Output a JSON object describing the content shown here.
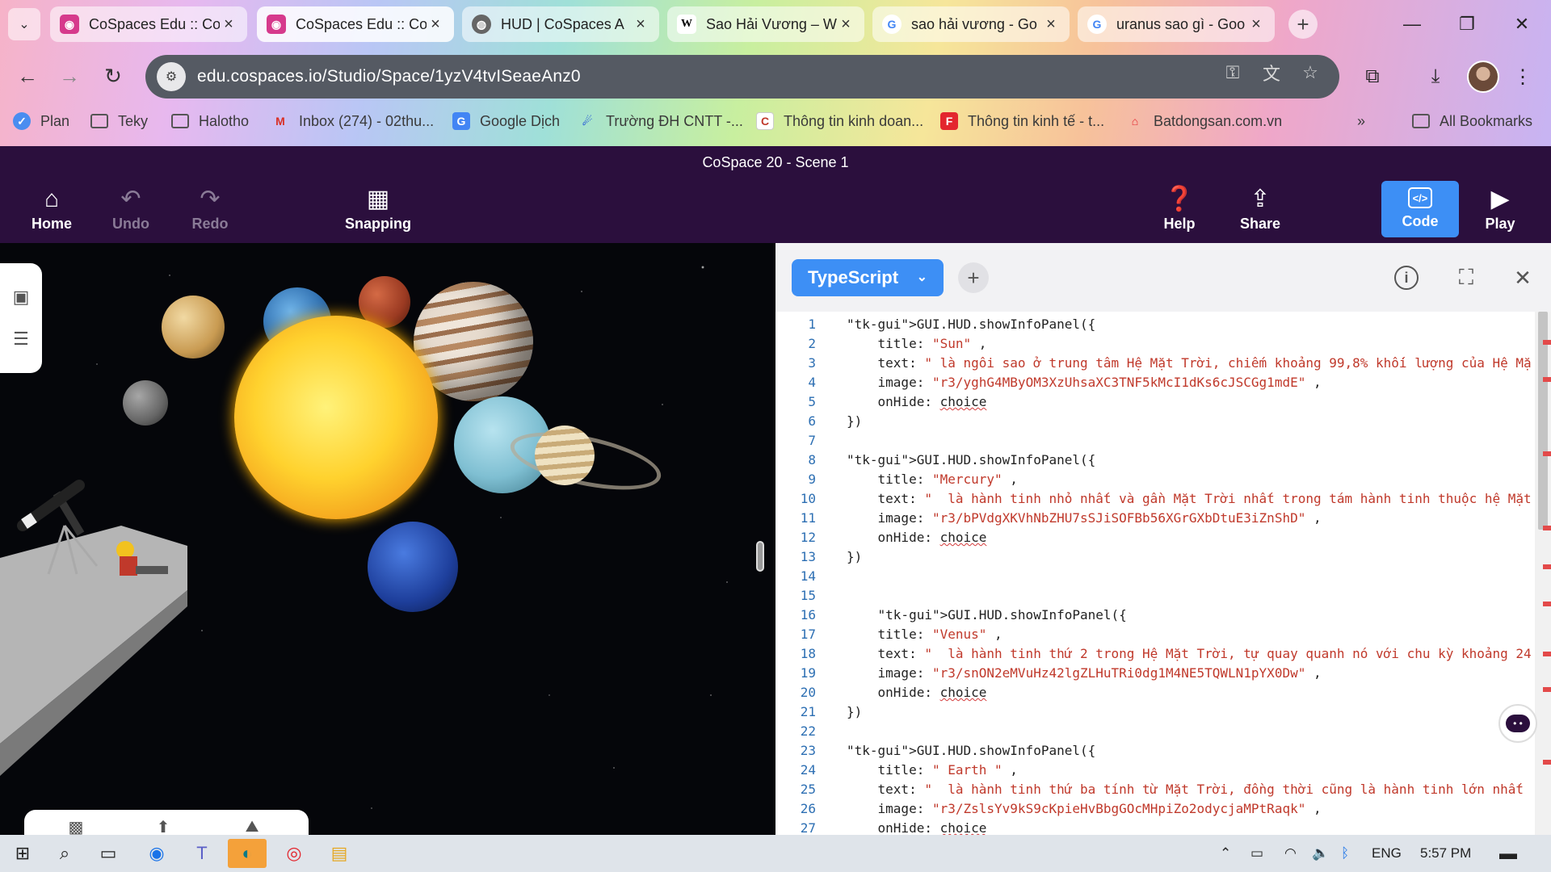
{
  "browser": {
    "tabs": [
      {
        "title": "CoSpaces Edu :: Co",
        "icon": "cospaces-icon",
        "active": false
      },
      {
        "title": "CoSpaces Edu :: Co",
        "icon": "cospaces-icon",
        "active": true
      },
      {
        "title": "HUD | CoSpaces A",
        "icon": "globe-icon",
        "active": false
      },
      {
        "title": "Sao Hải Vương – W",
        "icon": "wikipedia-icon",
        "active": false
      },
      {
        "title": "sao hải vương - Go",
        "icon": "google-icon",
        "active": false
      },
      {
        "title": "uranus sao gì - Goo",
        "icon": "google-icon",
        "active": false
      }
    ],
    "url": "edu.cospaces.io/Studio/Space/1yzV4tvISeaeAnz0",
    "bookmarks": [
      {
        "label": "Plan",
        "icon": "check-icon"
      },
      {
        "label": "Teky",
        "icon": "folder-icon"
      },
      {
        "label": "Halotho",
        "icon": "folder-icon"
      },
      {
        "label": "Inbox (274) - 02thu...",
        "icon": "gmail-icon"
      },
      {
        "label": "Google Dịch",
        "icon": "translate-icon"
      },
      {
        "label": "Trường ĐH CNTT -...",
        "icon": "swirl-icon"
      },
      {
        "label": "Thông tin kinh doan...",
        "icon": "c-logo-icon"
      },
      {
        "label": "Thông tin kinh tế - t...",
        "icon": "f-logo-icon"
      },
      {
        "label": "Batdongsan.com.vn",
        "icon": "house-icon"
      }
    ],
    "all_bookmarks": "All Bookmarks"
  },
  "app": {
    "scene_title": "CoSpace 20 - Scene 1",
    "toolbar": {
      "home": "Home",
      "undo": "Undo",
      "redo": "Redo",
      "snapping": "Snapping",
      "help": "Help",
      "share": "Share",
      "code": "Code",
      "play": "Play"
    },
    "code_panel": {
      "language": "TypeScript",
      "lines": [
        {
          "n": "1",
          "t": "GUI.HUD.showInfoPanel({"
        },
        {
          "n": "2",
          "t": "    title: \"Sun\" ,"
        },
        {
          "n": "3",
          "t": "    text: \" là ngôi sao ở trung tâm Hệ Mặt Trời, chiếm khoảng 99,8% khối lượng của Hệ Mặ"
        },
        {
          "n": "4",
          "t": "    image: \"r3/yghG4MByOM3XzUhsaXC3TNF5kMcI1dKs6cJSCGg1mdE\" ,"
        },
        {
          "n": "5",
          "t": "    onHide: choice"
        },
        {
          "n": "6",
          "t": "})"
        },
        {
          "n": "7",
          "t": ""
        },
        {
          "n": "8",
          "t": "GUI.HUD.showInfoPanel({"
        },
        {
          "n": "9",
          "t": "    title: \"Mercury\" ,"
        },
        {
          "n": "10",
          "t": "    text: \"  là hành tinh nhỏ nhất và gần Mặt Trời nhất trong tám hành tinh thuộc hệ Mặt"
        },
        {
          "n": "11",
          "t": "    image: \"r3/bPVdgXKVhNbZHU7sSJiSOFBb56XGrGXbDtuE3iZnShD\" ,"
        },
        {
          "n": "12",
          "t": "    onHide: choice"
        },
        {
          "n": "13",
          "t": "})"
        },
        {
          "n": "14",
          "t": ""
        },
        {
          "n": "15",
          "t": ""
        },
        {
          "n": "16",
          "t": "    GUI.HUD.showInfoPanel({"
        },
        {
          "n": "17",
          "t": "    title: \"Venus\" ,"
        },
        {
          "n": "18",
          "t": "    text: \"  là hành tinh thứ 2 trong Hệ Mặt Trời, tự quay quanh nó với chu kỳ khoảng 24"
        },
        {
          "n": "19",
          "t": "    image: \"r3/snON2eMVuHz42lgZLHuTRi0dg1M4NE5TQWLN1pYX0Dw\" ,"
        },
        {
          "n": "20",
          "t": "    onHide: choice"
        },
        {
          "n": "21",
          "t": "})"
        },
        {
          "n": "22",
          "t": ""
        },
        {
          "n": "23",
          "t": "GUI.HUD.showInfoPanel({"
        },
        {
          "n": "24",
          "t": "    title: \" Earth \" ,"
        },
        {
          "n": "25",
          "t": "    text: \"  là hành tinh thứ ba tính từ Mặt Trời, đồng thời cũng là hành tinh lớn nhất"
        },
        {
          "n": "26",
          "t": "    image: \"r3/ZslsYv9kS9cKpieHvBbgGOcMHpiZo2odycjaMPtRaqk\" ,"
        },
        {
          "n": "27",
          "t": "    onHide: choice"
        }
      ]
    }
  },
  "taskbar": {
    "language": "ENG",
    "time": "5:57 PM"
  },
  "colors": {
    "header_bg": "#2b0f3d",
    "accent_blue": "#3d8ff5",
    "code_string": "#c0392b",
    "line_number": "#2d6fb3"
  }
}
